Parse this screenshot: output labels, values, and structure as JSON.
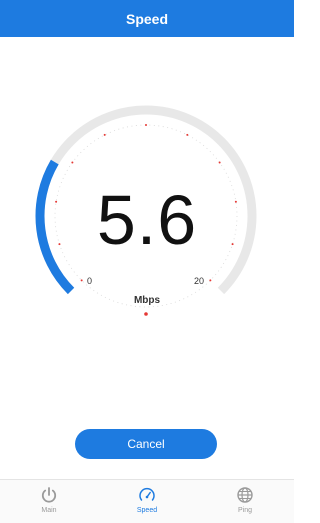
{
  "header": {
    "title": "Speed"
  },
  "gauge": {
    "value": "5.6",
    "unit": "Mbps",
    "min_label": "0",
    "max_label": "20",
    "progress_fraction": 0.28,
    "accent_color": "#1e7be0",
    "track_color": "#e8e8e8",
    "indicator_color": "#e53935"
  },
  "actions": {
    "cancel_label": "Cancel"
  },
  "tabbar": {
    "tabs": [
      {
        "label": "Main",
        "icon": "power-icon",
        "active": false
      },
      {
        "label": "Speed",
        "icon": "speedometer-icon",
        "active": true
      },
      {
        "label": "Ping",
        "icon": "globe-icon",
        "active": false
      }
    ]
  }
}
